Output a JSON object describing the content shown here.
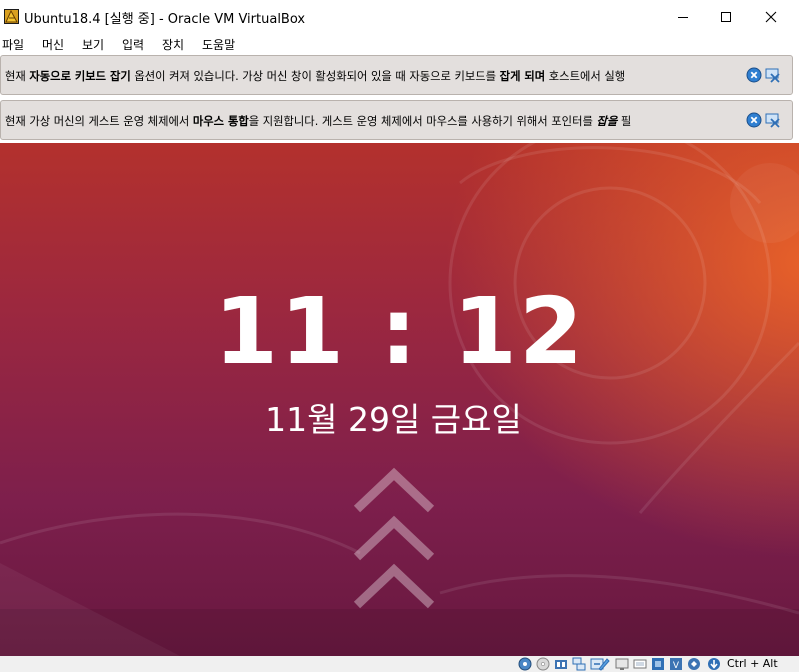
{
  "window": {
    "title": "Ubuntu18.4 [실행 중] - Oracle VM VirtualBox",
    "minimize_icon": "minimize-icon",
    "maximize_icon": "maximize-icon",
    "close_icon": "close-icon"
  },
  "menu": [
    "파일",
    "머신",
    "보기",
    "입력",
    "장치",
    "도움말"
  ],
  "notices": [
    {
      "parts": [
        {
          "text": "현재 ",
          "bold": false
        },
        {
          "text": "자동으로 키보드 잡기",
          "bold": true
        },
        {
          "text": " 옵션이 켜져 있습니다. 가상 머신 창이 활성화되어 있을 때 자동으로 키보드를 ",
          "bold": false
        },
        {
          "text": "잡게 되며",
          "bold": true
        },
        {
          "text": " 호스트에서 실행",
          "bold": false
        }
      ],
      "icons": [
        "dismiss-notice-icon",
        "do-not-show-again-icon"
      ]
    },
    {
      "parts": [
        {
          "text": "현재 가상 머신의 게스트 운영 체제에서 ",
          "bold": false
        },
        {
          "text": "마우스 통합",
          "bold": true
        },
        {
          "text": "을 지원합니다. 게스트 운영 체제에서 마우스를 사용하기 위해서 포인터를 ",
          "bold": false
        },
        {
          "text": "잡을",
          "bold": true
        },
        {
          "text": " 필",
          "bold": false
        }
      ],
      "icons": [
        "dismiss-notice-icon",
        "do-not-show-again-icon"
      ]
    }
  ],
  "lockscreen": {
    "time": "11 : 12",
    "date": "11월 29일 금요일"
  },
  "colors": {
    "orange": "#e95420",
    "aubergine": "#77216f"
  },
  "statusbar": {
    "icons": [
      "hard-disk-icon",
      "optical-drive-icon",
      "audio-icon",
      "network-icon",
      "usb-icon",
      "shared-folders-icon",
      "display-icon",
      "video-capture-icon",
      "cpu-icon",
      "mouse-integration-icon",
      "keyboard-icon"
    ],
    "host_key": "Ctrl + Alt"
  }
}
